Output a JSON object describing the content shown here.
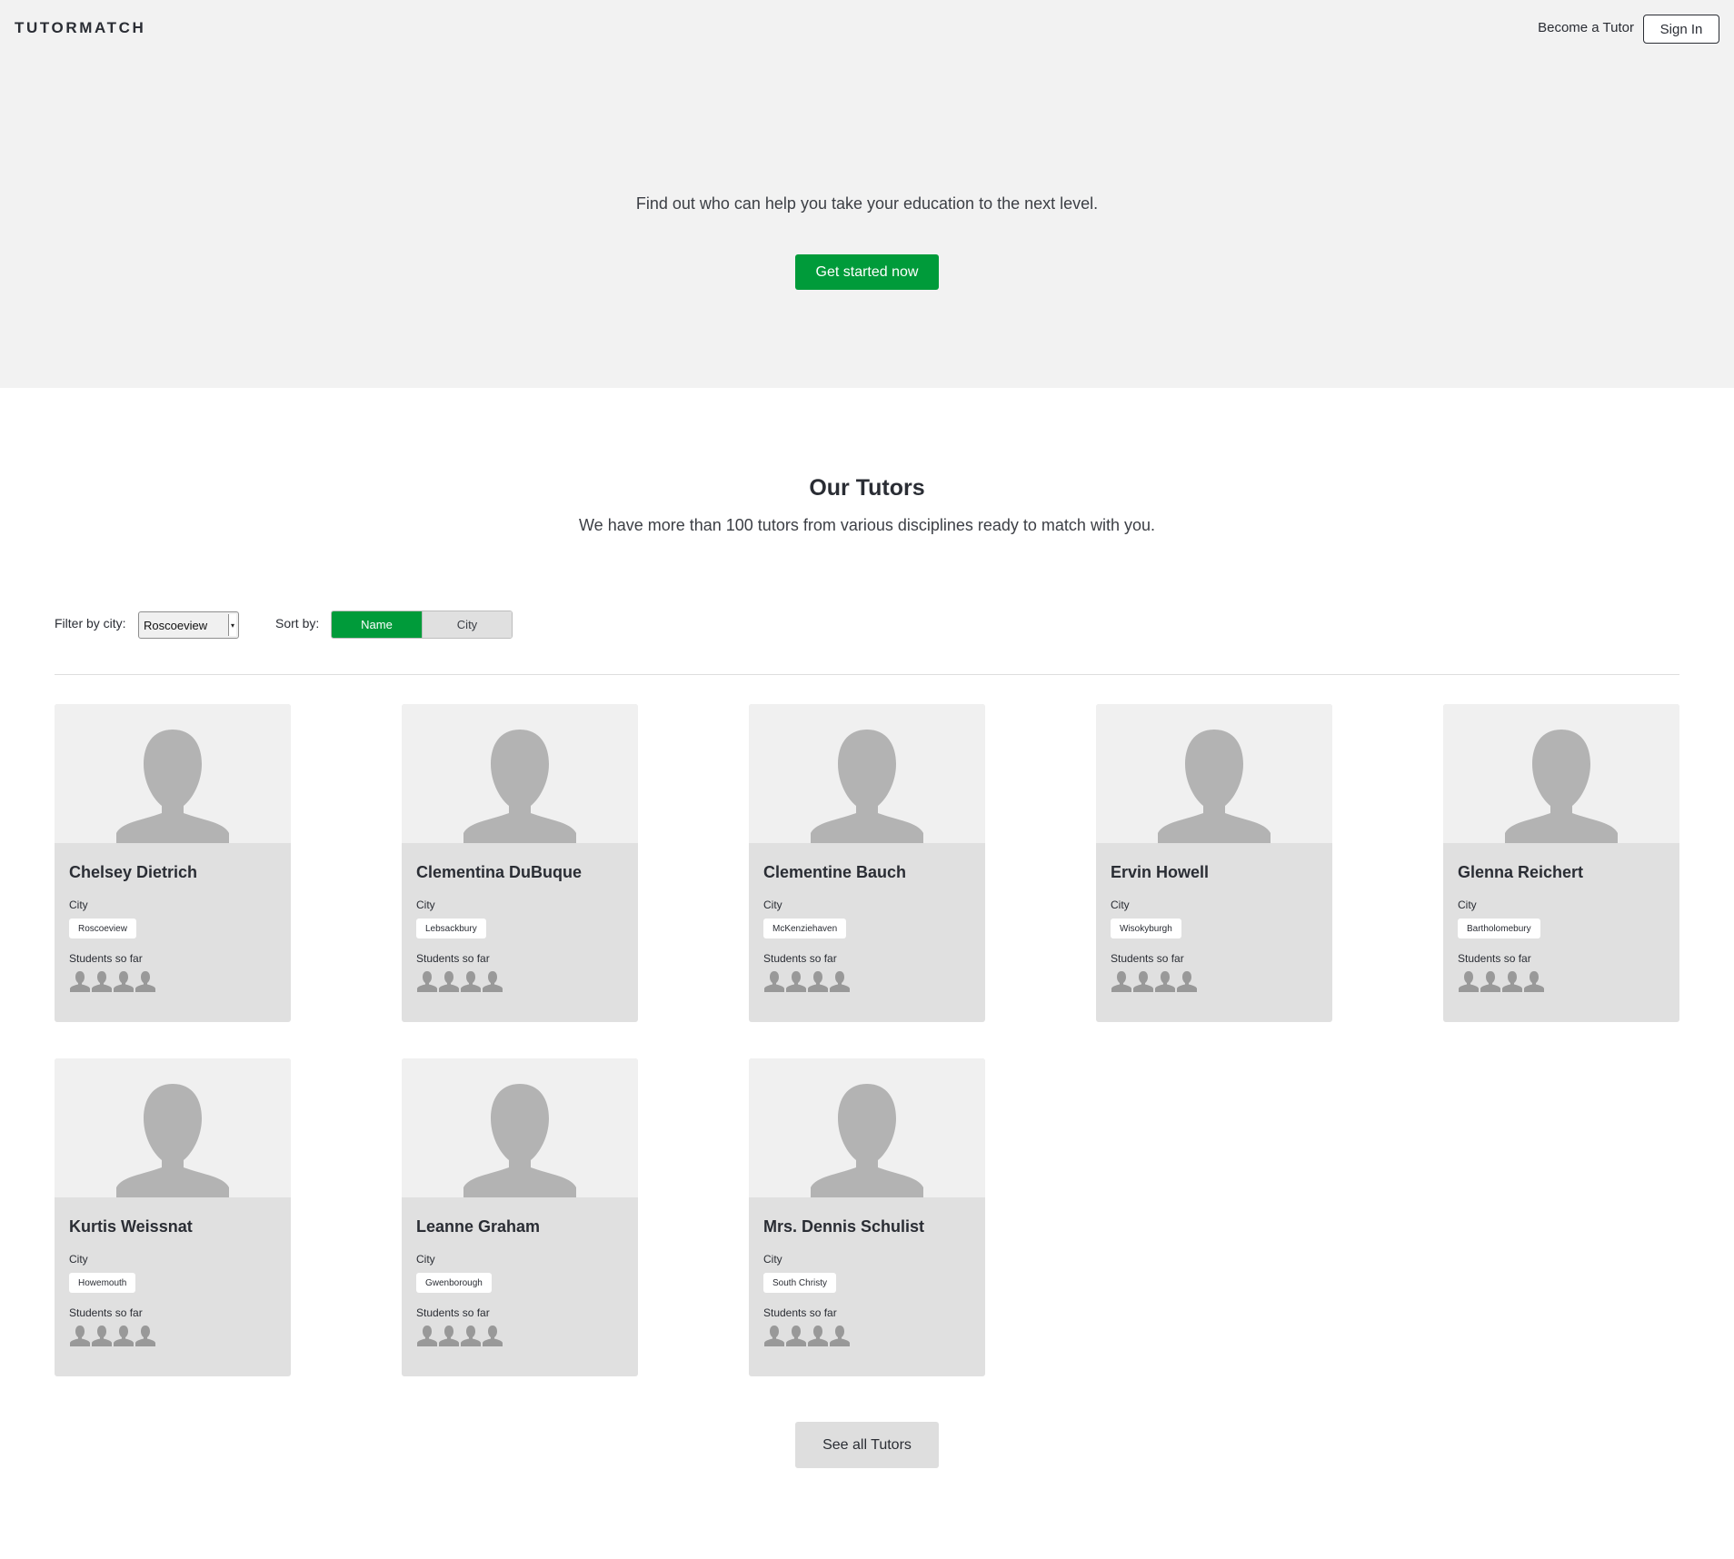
{
  "header": {
    "logo": "TUTORMATCH",
    "become_tutor": "Become a Tutor",
    "sign_in": "Sign In"
  },
  "hero": {
    "text": "Find out who can help you take your education to the next level.",
    "cta": "Get started now"
  },
  "tutors_section": {
    "title": "Our Tutors",
    "subtitle": "We have more than 100 tutors from various disciplines ready to match with you.",
    "filter_label": "Filter by city:",
    "filter_selected": "Roscoeview",
    "sort_label": "Sort by:",
    "sort_options": [
      "Name",
      "City"
    ],
    "sort_active": "Name",
    "city_label": "City",
    "students_label": "Students so far",
    "see_all": "See all Tutors"
  },
  "tutors": [
    {
      "name": "Chelsey Dietrich",
      "city": "Roscoeview"
    },
    {
      "name": "Clementina DuBuque",
      "city": "Lebsackbury"
    },
    {
      "name": "Clementine Bauch",
      "city": "McKenziehaven"
    },
    {
      "name": "Ervin Howell",
      "city": "Wisokyburgh"
    },
    {
      "name": "Glenna Reichert",
      "city": "Bartholomebury"
    },
    {
      "name": "Kurtis Weissnat",
      "city": "Howemouth"
    },
    {
      "name": "Leanne Graham",
      "city": "Gwenborough"
    },
    {
      "name": "Mrs. Dennis Schulist",
      "city": "South Christy"
    }
  ],
  "icons": {
    "photo": "avatar-placeholder-icon",
    "student": "student-icon"
  },
  "colors": {
    "accent": "#009b3a",
    "hero_bg": "#f2f2f2",
    "card_bg": "#e0e0e0",
    "photo_bg": "#f0f0f0",
    "avatar": "#b3b3b3",
    "student_icon": "#999999",
    "text": "#2a2d34"
  }
}
